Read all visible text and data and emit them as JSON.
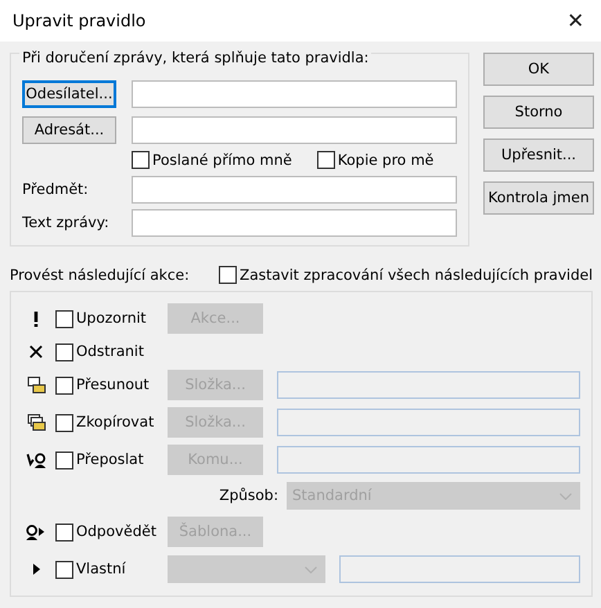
{
  "window": {
    "title": "Upravit pravidlo",
    "close": "✕"
  },
  "conditions": {
    "legend": "Při doručení zprávy, která splňuje tato pravidla:",
    "address_rows": [
      {
        "button": "Odesílatel...",
        "focused": true
      },
      {
        "button": "Adresát...",
        "focused": false
      }
    ],
    "checkboxes": [
      {
        "label": "Poslané přímo mně",
        "checked": false
      },
      {
        "label": "Kopie pro mě",
        "checked": false
      }
    ],
    "text_rows": [
      {
        "label": "Předmět:"
      },
      {
        "label": "Text zprávy:"
      }
    ]
  },
  "side_buttons": [
    "OK",
    "Storno",
    "Upřesnit...",
    "Kontrola jmen"
  ],
  "actions_heading": "Provést následující akce:",
  "stop_processing": {
    "label": "Zastavit zpracování všech následujících pravidel",
    "checked": false
  },
  "actions": [
    {
      "kind": "alert",
      "label": "Upozornit",
      "checked": false,
      "button": "Akce...",
      "disabled": true
    },
    {
      "kind": "delete",
      "label": "Odstranit",
      "checked": false
    },
    {
      "kind": "move",
      "label": "Přesunout",
      "checked": false,
      "button": "Složka...",
      "disabled": true
    },
    {
      "kind": "copy",
      "label": "Zkopírovat",
      "checked": false,
      "button": "Složka...",
      "disabled": true
    },
    {
      "kind": "forward",
      "label": "Přeposlat",
      "checked": false,
      "button": "Komu...",
      "disabled": true
    },
    {
      "kind": "method",
      "label": "Způsob:",
      "value": "Standardní",
      "disabled": true
    },
    {
      "kind": "reply",
      "label": "Odpovědět",
      "checked": false,
      "button": "Šablona...",
      "disabled": true
    },
    {
      "kind": "custom",
      "label": "Vlastní",
      "checked": false,
      "disabled": true
    }
  ]
}
